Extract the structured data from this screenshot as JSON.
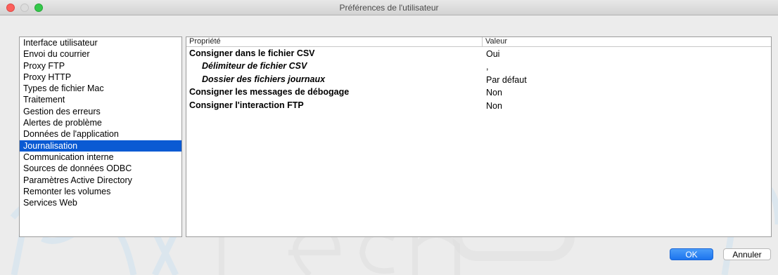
{
  "window": {
    "title": "Préférences de l'utilisateur"
  },
  "categories": [
    "Interface utilisateur",
    "Envoi du courrier",
    "Proxy FTP",
    "Proxy HTTP",
    "Types de fichier Mac",
    "Traitement",
    "Gestion des erreurs",
    "Alertes de problème",
    "Données de l'application",
    "Journalisation",
    "Communication interne",
    "Sources de données ODBC",
    "Paramètres Active Directory",
    "Remonter les volumes",
    "Services Web"
  ],
  "selected_category": "Journalisation",
  "properties": {
    "headers": {
      "property": "Propriété",
      "value": "Valeur"
    },
    "rows": [
      {
        "name": "Consigner dans le fichier CSV",
        "value": "Oui",
        "indent": false
      },
      {
        "name": "Délimiteur de fichier CSV",
        "value": ",",
        "indent": true
      },
      {
        "name": "Dossier des fichiers journaux",
        "value": "Par défaut",
        "indent": true
      },
      {
        "name": "Consigner les messages de débogage",
        "value": "Non",
        "indent": false
      },
      {
        "name": "Consigner l'interaction FTP",
        "value": "Non",
        "indent": false
      }
    ]
  },
  "buttons": {
    "ok": "OK",
    "cancel": "Annuler"
  },
  "watermark": {
    "text": "PixelTech"
  },
  "colors": {
    "selection": "#0a5ad3",
    "ok_button": "#1c74ee"
  }
}
